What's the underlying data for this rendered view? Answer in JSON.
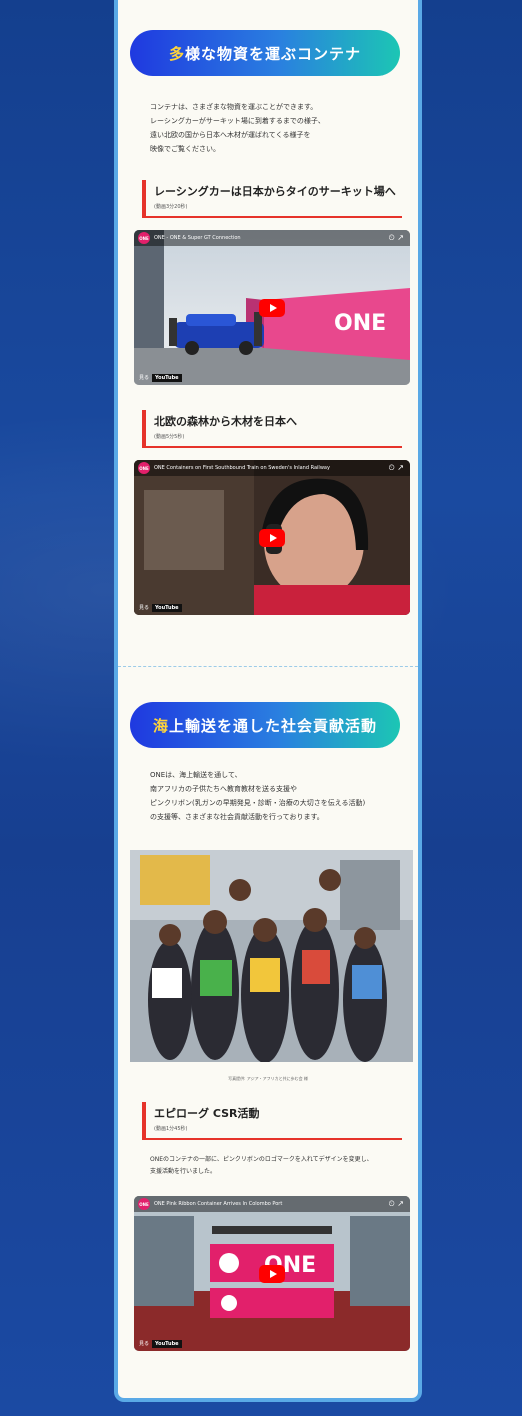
{
  "section1": {
    "title_first": "多",
    "title_rest": "様な物資を運ぶコンテナ",
    "intro": [
      "コンテナは、さまざまな物資を運ぶことができます。",
      "レーシングカーがサーキット場に到着するまでの様子、",
      "遠い北欧の国から日本へ木材が運ばれてくる様子を",
      "映像でご覧ください。"
    ],
    "heading1": {
      "title": "レーシングカーは日本からタイのサーキット場へ",
      "sub": "(動画3分20秒)"
    },
    "video1": {
      "logo": "ONE",
      "title": "ONE - ONE & Super GT Connection",
      "watch_label": "見る",
      "brand": "YouTube",
      "container_text": "ONE"
    },
    "heading2": {
      "title": "北欧の森林から木材を日本へ",
      "sub": "(動画5分5秒)"
    },
    "video2": {
      "logo": "ONE",
      "title": "ONE Containers on First Southbound Train on Sweden's Inland Railway",
      "watch_label": "見る",
      "brand": "YouTube"
    }
  },
  "section2": {
    "title_first": "海",
    "title_rest": "上輸送を通した社会貢献活動",
    "intro": [
      "ONEは、海上輸送を通して、",
      "南アフリカの子供たちへ教育教材を送る支援や",
      "ピンクリボン(乳ガンの早期発見・診断・治療の大切さを伝える活動)",
      "の支援等、さまざまな社会貢献活動を行っております。"
    ],
    "photo_caption": "写真提供: アジア・アフリカと共に歩む会 様",
    "heading3": {
      "title": "エピローグ CSR活動",
      "sub": "(動画1分45秒)"
    },
    "text": [
      "ONEのコンテナの一部に、ピンクリボンのロゴマークを入れてデザインを変更し、",
      "支援活動を行いました。"
    ],
    "video3": {
      "logo": "ONE",
      "title": "ONE Pink Ribbon Container Arrives In Colombo Port",
      "watch_label": "見る",
      "brand": "YouTube",
      "container_text": "ONE"
    }
  },
  "colors": {
    "accent_red": "#e6332a",
    "pill_start": "#1f39e0",
    "pill_end": "#1cc6b4",
    "card_bg": "#fbfaf4",
    "page_bg": "#143f8e"
  }
}
